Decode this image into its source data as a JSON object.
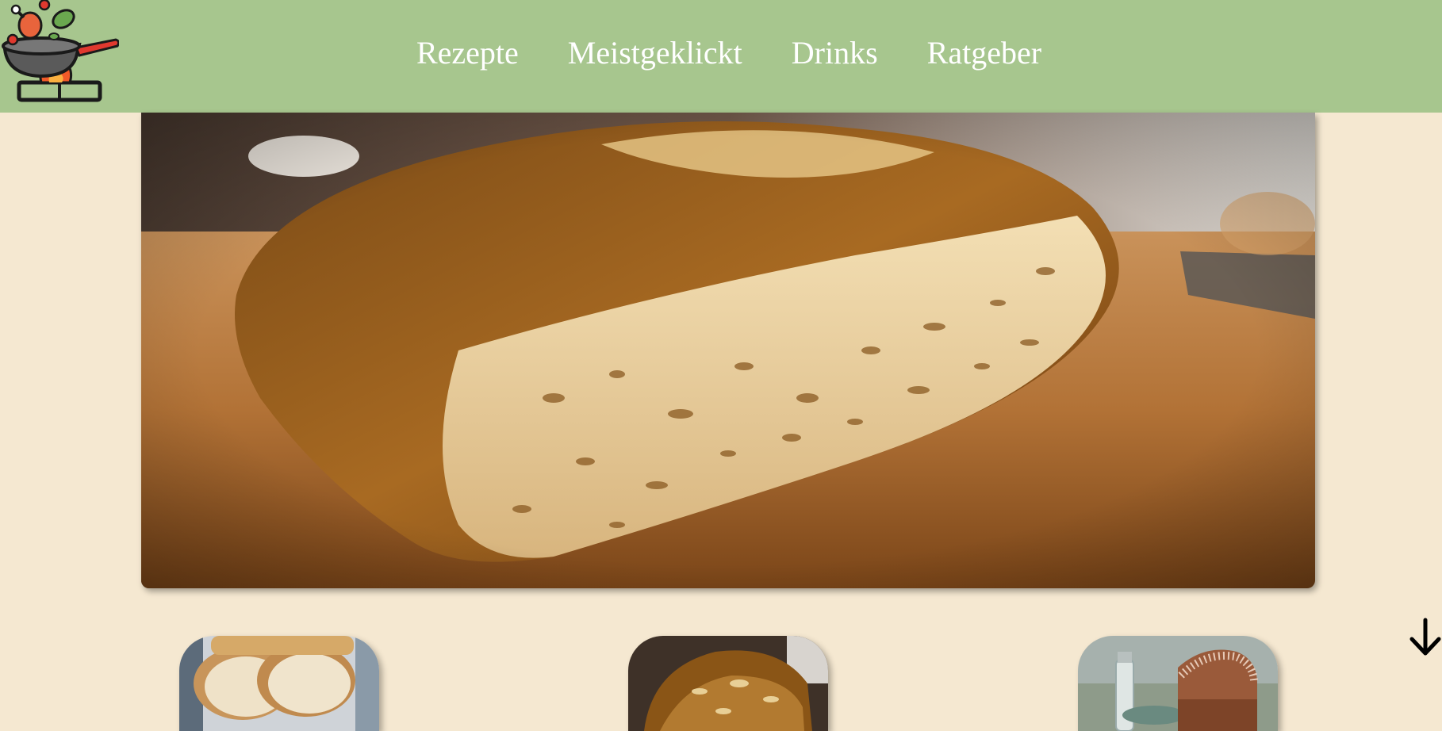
{
  "nav": {
    "items": [
      {
        "label": "Rezepte"
      },
      {
        "label": "Meistgeklickt"
      },
      {
        "label": "Drinks"
      },
      {
        "label": "Ratgeber"
      }
    ]
  },
  "logo": {
    "icon": "cooking-pan-logo-icon"
  },
  "hero": {
    "image": "bread-loaf-photo"
  },
  "recipe_cards": [
    {
      "image": "sliced-white-bread-photo"
    },
    {
      "image": "crusty-bread-loaf-photo"
    },
    {
      "image": "wholegrain-bread-loaf-photo"
    }
  ],
  "scroll": {
    "icon": "arrow-down-icon"
  },
  "colors": {
    "header": "#a7c68e",
    "background": "#f5e8d1",
    "nav_text": "#ffffff"
  }
}
